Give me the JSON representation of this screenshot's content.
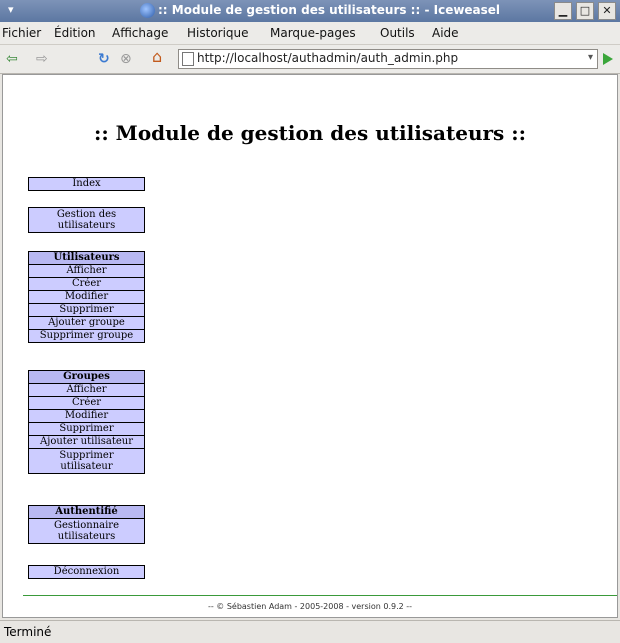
{
  "window": {
    "title": ":: Module de gestion des utilisateurs :: - Iceweasel",
    "menu_glyph": "▾",
    "controls": [
      "▁",
      "□",
      "✕"
    ]
  },
  "menubar": [
    "Fichier",
    "Édition",
    "Affichage",
    "Historique",
    "Marque-pages",
    "Outils",
    "Aide"
  ],
  "navbar": {
    "back": "⇦",
    "forward": "⇨",
    "reload": "↻",
    "stop": "⊗",
    "home": "⌂",
    "url": "http://localhost/authadmin/auth_admin.php",
    "url_dropdown": "▾"
  },
  "page": {
    "title": ":: Module de gestion des utilisateurs ::",
    "menu": {
      "index": "Index",
      "gestion": [
        "Gestion des",
        "utilisateurs"
      ],
      "utilisateurs": {
        "header": "Utilisateurs",
        "items": [
          "Afficher",
          "Créer",
          "Modifier",
          "Supprimer",
          "Ajouter groupe",
          "Supprimer groupe"
        ]
      },
      "groupes": {
        "header": "Groupes",
        "items": [
          "Afficher",
          "Créer",
          "Modifier",
          "Supprimer",
          "Ajouter utilisateur"
        ],
        "last": [
          "Supprimer",
          "utilisateur"
        ]
      },
      "authentifie": {
        "header": "Authentifié",
        "items": [
          "Gestionnaire",
          "utilisateurs"
        ]
      },
      "deconnexion": "Déconnexion"
    },
    "footer": "-- © Sébastien Adam - 2005-2008 - version 0.9.2 --"
  },
  "status": "Terminé",
  "colors": {
    "menu_bg": "#ccccff",
    "footer_rule": "#3a9a3a"
  }
}
